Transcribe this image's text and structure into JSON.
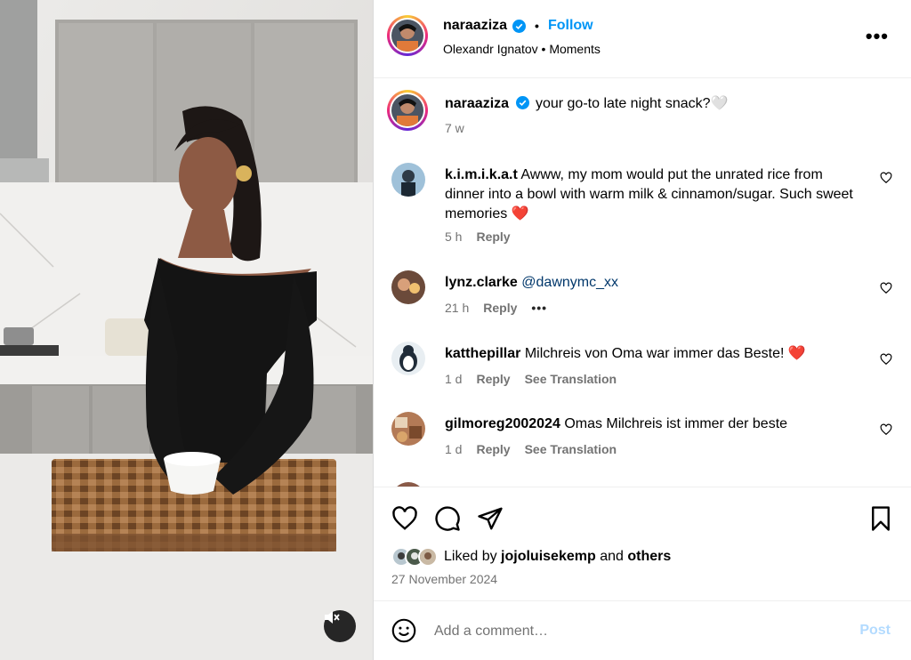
{
  "post": {
    "username": "naraaziza",
    "follow_label": "Follow",
    "separator": "•",
    "audio": "Olexandr Ignatov",
    "audio_sep": "•",
    "audio_type": "Moments",
    "more_label": "•••"
  },
  "caption": {
    "username": "naraaziza",
    "text": "your go-to late night snack?🤍",
    "time": "7 w"
  },
  "comments": [
    {
      "username": "k.i.m.i.k.a.t",
      "text": "Awww, my mom would put the unrated rice from dinner into a bowl with warm milk & cinnamon/sugar. Such sweet memories ❤️",
      "time": "5 h",
      "reply_label": "Reply"
    },
    {
      "username": "lynz.clarke",
      "mention": "@dawnymc_xx",
      "time": "21 h",
      "reply_label": "Reply",
      "options_label": "•••"
    },
    {
      "username": "katthepillar",
      "text": "Milchreis von Oma war immer das Beste! ❤️",
      "time": "1 d",
      "reply_label": "Reply",
      "translate_label": "See Translation"
    },
    {
      "username": "gilmoreg2002024",
      "text": "Omas Milchreis ist immer der beste",
      "time": "1 d",
      "reply_label": "Reply",
      "translate_label": "See Translation"
    }
  ],
  "likes": {
    "prefix": "Liked by",
    "user": "jojoluisekemp",
    "and": "and",
    "others": "others"
  },
  "date": "27 November 2024",
  "add_comment": {
    "placeholder": "Add a comment…",
    "post_label": "Post"
  },
  "colors": {
    "accent": "#0095f6",
    "muted": "#737373",
    "heart": "#ed4956",
    "post_disabled": "#b3dbff"
  },
  "icons": {
    "verified": "verified-badge-icon",
    "more": "more-options-icon",
    "like": "heart-icon",
    "comment": "comment-bubble-icon",
    "share": "paper-plane-icon",
    "save": "bookmark-icon",
    "emoji": "emoji-smile-icon",
    "mute": "speaker-muted-icon"
  }
}
